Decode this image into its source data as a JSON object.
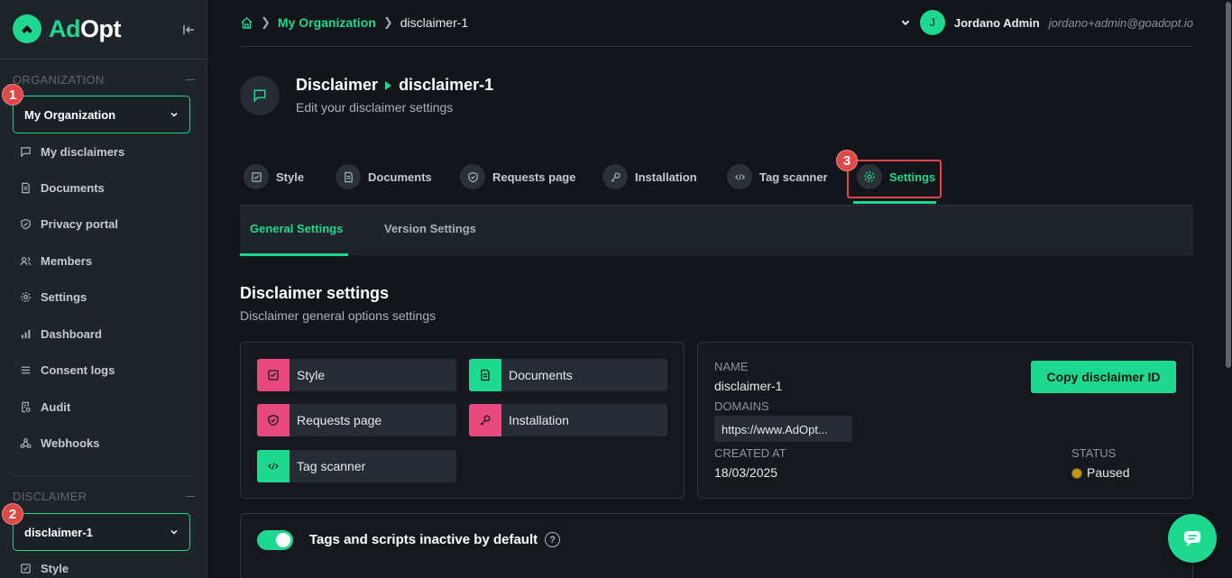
{
  "brand": {
    "name_part1": "Ad",
    "name_part2": "Opt"
  },
  "sidebar": {
    "organization_section": "ORGANIZATION",
    "organization_select": "My Organization",
    "org_items": [
      {
        "label": "My disclaimers",
        "icon": "chat-icon"
      },
      {
        "label": "Documents",
        "icon": "document-icon"
      },
      {
        "label": "Privacy portal",
        "icon": "shield-icon"
      },
      {
        "label": "Members",
        "icon": "users-icon"
      },
      {
        "label": "Settings",
        "icon": "gear-icon"
      },
      {
        "label": "Dashboard",
        "icon": "bar-chart-icon"
      },
      {
        "label": "Consent logs",
        "icon": "list-icon"
      },
      {
        "label": "Audit",
        "icon": "audit-icon"
      },
      {
        "label": "Webhooks",
        "icon": "webhook-icon"
      }
    ],
    "disclaimer_section": "DISCLAIMER",
    "disclaimer_select": "disclaimer-1",
    "disclaimer_items": [
      {
        "label": "Style",
        "icon": "style-icon"
      }
    ],
    "badges": [
      "1",
      "2",
      "3"
    ]
  },
  "topbar": {
    "breadcrumb_org": "My Organization",
    "breadcrumb_current": "disclaimer-1",
    "user_initial": "J",
    "user_name": "Jordano Admin",
    "user_email": "jordano+admin@goadopt.io"
  },
  "header": {
    "title_part1": "Disclaimer",
    "title_part2": "disclaimer-1",
    "subtitle": "Edit your disclaimer settings"
  },
  "tabs": [
    {
      "label": "Style",
      "icon": "style-icon"
    },
    {
      "label": "Documents",
      "icon": "document-icon"
    },
    {
      "label": "Requests page",
      "icon": "shield-icon"
    },
    {
      "label": "Installation",
      "icon": "key-icon"
    },
    {
      "label": "Tag scanner",
      "icon": "code-icon"
    },
    {
      "label": "Settings",
      "icon": "gear-icon"
    }
  ],
  "subtabs": [
    {
      "label": "General Settings"
    },
    {
      "label": "Version Settings"
    }
  ],
  "section": {
    "title": "Disclaimer settings",
    "subtitle": "Disclaimer general options settings"
  },
  "shortcuts": [
    {
      "label": "Style",
      "color": "#e84a7f"
    },
    {
      "label": "Documents",
      "color": "#1fd88f"
    },
    {
      "label": "Requests page",
      "color": "#e84a7f"
    },
    {
      "label": "Installation",
      "color": "#e84a7f"
    },
    {
      "label": "Tag scanner",
      "color": "#1fd88f"
    }
  ],
  "info": {
    "name_label": "NAME",
    "name_value": "disclaimer-1",
    "domains_label": "DOMAINS",
    "domain_value": "https://www.AdOpt...",
    "created_label": "CREATED AT",
    "created_value": "18/03/2025",
    "status_label": "STATUS",
    "status_value": "Paused",
    "copy_button": "Copy disclaimer ID"
  },
  "toggle": {
    "label": "Tags and scripts inactive by default",
    "help": "?"
  },
  "colors": {
    "accent": "#1fd88f",
    "pink": "#e84a7f",
    "badge": "#e04848",
    "paused": "#c39a1d"
  }
}
